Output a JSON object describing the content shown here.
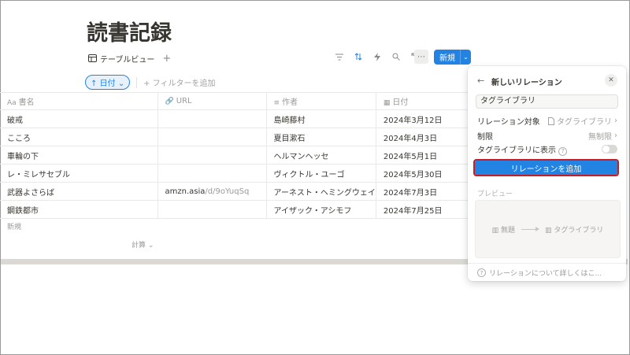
{
  "page": {
    "title": "読書記録"
  },
  "view": {
    "tab_label": "テーブルビュー",
    "add": "+",
    "more": "⋯",
    "new_label": "新規",
    "new_chevron": "⌄"
  },
  "filter": {
    "date_chip": "↑ 日付 ⌄",
    "add_filter": "+ フィルターを追加"
  },
  "table": {
    "headers": [
      {
        "icon": "Aa",
        "label": "書名"
      },
      {
        "icon": "🔗",
        "label": "URL"
      },
      {
        "icon": "≡",
        "label": "作者"
      },
      {
        "icon": "▦",
        "label": "日付"
      }
    ],
    "rows": [
      {
        "title": "破戒",
        "url_host": "",
        "url_path": "",
        "author": "島崎藤村",
        "date": "2024年3月12日"
      },
      {
        "title": "こころ",
        "url_host": "",
        "url_path": "",
        "author": "夏目漱石",
        "date": "2024年4月3日"
      },
      {
        "title": "車輪の下",
        "url_host": "",
        "url_path": "",
        "author": "ヘルマンヘッセ",
        "date": "2024年5月1日"
      },
      {
        "title": "レ・ミレサセブル",
        "url_host": "",
        "url_path": "",
        "author": "ヴィクトル・ユーゴ",
        "date": "2024年5月30日"
      },
      {
        "title": "武器よさらば",
        "url_host": "amzn.asia",
        "url_path": "/d/9oYuqSq",
        "author": "アーネスト・ヘミングウェイ",
        "date": "2024年7月3日"
      },
      {
        "title": "鋼鉄都市",
        "url_host": "",
        "url_path": "",
        "author": "アイザック・アシモフ",
        "date": "2024年7月25日"
      }
    ],
    "new_row": "新規",
    "calc": "計算 ⌄"
  },
  "panel": {
    "back": "←",
    "title": "新しいリレーション",
    "close": "✕",
    "name_value": "タグライブラリ",
    "target_label": "リレーション対象",
    "target_value": "タグライブラリ",
    "limit_label": "制限",
    "limit_value": "無制限",
    "show_label": "タグライブラリに表示",
    "add_button": "リレーションを追加",
    "preview_label": "プレビュー",
    "preview_from": "▥ 無題",
    "preview_to": "▥ タグライブラリ",
    "learn_more": "リレーションについて詳しくはこ..."
  },
  "colors": {
    "accent": "#2383e2",
    "highlight_border": "#c81d25"
  }
}
